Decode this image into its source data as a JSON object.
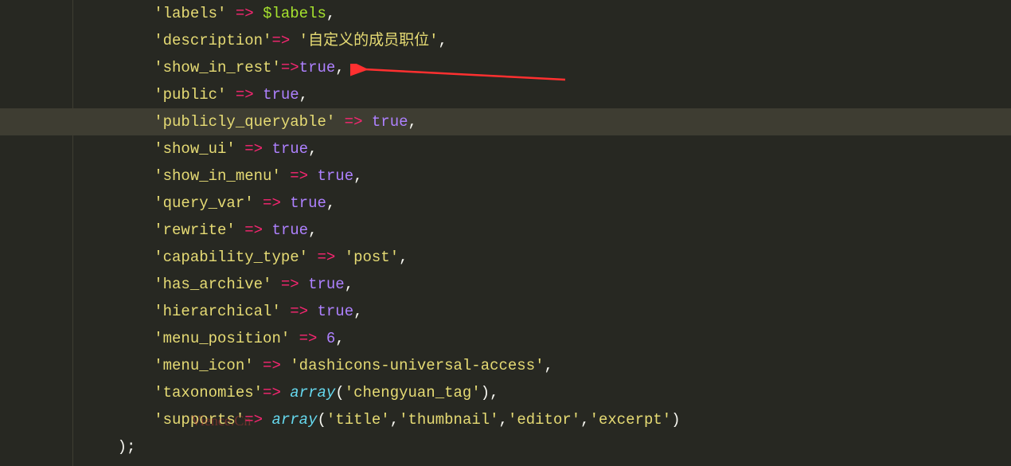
{
  "code": {
    "lines": [
      {
        "indent": "        ",
        "tokens": [
          {
            "t": "string",
            "v": "'labels'"
          },
          {
            "t": "punct",
            "v": " "
          },
          {
            "t": "operator",
            "v": "=>"
          },
          {
            "t": "punct",
            "v": " "
          },
          {
            "t": "variable",
            "v": "$labels"
          },
          {
            "t": "punct",
            "v": ","
          }
        ]
      },
      {
        "indent": "        ",
        "tokens": [
          {
            "t": "string",
            "v": "'description'"
          },
          {
            "t": "operator",
            "v": "=>"
          },
          {
            "t": "punct",
            "v": " "
          },
          {
            "t": "string",
            "v": "'自定义的成员职位'"
          },
          {
            "t": "punct",
            "v": ","
          }
        ]
      },
      {
        "indent": "        ",
        "tokens": [
          {
            "t": "string",
            "v": "'show_in_rest'"
          },
          {
            "t": "operator",
            "v": "=>"
          },
          {
            "t": "keyword",
            "v": "true"
          },
          {
            "t": "punct",
            "v": ","
          }
        ]
      },
      {
        "indent": "        ",
        "tokens": [
          {
            "t": "string",
            "v": "'public'"
          },
          {
            "t": "punct",
            "v": " "
          },
          {
            "t": "operator",
            "v": "=>"
          },
          {
            "t": "punct",
            "v": " "
          },
          {
            "t": "keyword",
            "v": "true"
          },
          {
            "t": "punct",
            "v": ","
          }
        ]
      },
      {
        "indent": "        ",
        "tokens": [
          {
            "t": "string",
            "v": "'publicly_queryable'"
          },
          {
            "t": "punct",
            "v": " "
          },
          {
            "t": "operator",
            "v": "=>"
          },
          {
            "t": "punct",
            "v": " "
          },
          {
            "t": "keyword",
            "v": "true"
          },
          {
            "t": "punct",
            "v": ","
          }
        ],
        "highlighted": true
      },
      {
        "indent": "        ",
        "tokens": [
          {
            "t": "string",
            "v": "'show_ui'"
          },
          {
            "t": "punct",
            "v": " "
          },
          {
            "t": "operator",
            "v": "=>"
          },
          {
            "t": "punct",
            "v": " "
          },
          {
            "t": "keyword",
            "v": "true"
          },
          {
            "t": "punct",
            "v": ","
          }
        ]
      },
      {
        "indent": "        ",
        "tokens": [
          {
            "t": "string",
            "v": "'show_in_menu'"
          },
          {
            "t": "punct",
            "v": " "
          },
          {
            "t": "operator",
            "v": "=>"
          },
          {
            "t": "punct",
            "v": " "
          },
          {
            "t": "keyword",
            "v": "true"
          },
          {
            "t": "punct",
            "v": ","
          }
        ]
      },
      {
        "indent": "        ",
        "tokens": [
          {
            "t": "string",
            "v": "'query_var'"
          },
          {
            "t": "punct",
            "v": " "
          },
          {
            "t": "operator",
            "v": "=>"
          },
          {
            "t": "punct",
            "v": " "
          },
          {
            "t": "keyword",
            "v": "true"
          },
          {
            "t": "punct",
            "v": ","
          }
        ]
      },
      {
        "indent": "        ",
        "tokens": [
          {
            "t": "string",
            "v": "'rewrite'"
          },
          {
            "t": "punct",
            "v": " "
          },
          {
            "t": "operator",
            "v": "=>"
          },
          {
            "t": "punct",
            "v": " "
          },
          {
            "t": "keyword",
            "v": "true"
          },
          {
            "t": "punct",
            "v": ","
          }
        ]
      },
      {
        "indent": "        ",
        "tokens": [
          {
            "t": "string",
            "v": "'capability_type'"
          },
          {
            "t": "punct",
            "v": " "
          },
          {
            "t": "operator",
            "v": "=>"
          },
          {
            "t": "punct",
            "v": " "
          },
          {
            "t": "string",
            "v": "'post'"
          },
          {
            "t": "punct",
            "v": ","
          }
        ]
      },
      {
        "indent": "        ",
        "tokens": [
          {
            "t": "string",
            "v": "'has_archive'"
          },
          {
            "t": "punct",
            "v": " "
          },
          {
            "t": "operator",
            "v": "=>"
          },
          {
            "t": "punct",
            "v": " "
          },
          {
            "t": "keyword",
            "v": "true"
          },
          {
            "t": "punct",
            "v": ","
          }
        ]
      },
      {
        "indent": "        ",
        "tokens": [
          {
            "t": "string",
            "v": "'hierarchical'"
          },
          {
            "t": "punct",
            "v": " "
          },
          {
            "t": "operator",
            "v": "=>"
          },
          {
            "t": "punct",
            "v": " "
          },
          {
            "t": "keyword",
            "v": "true"
          },
          {
            "t": "punct",
            "v": ","
          }
        ]
      },
      {
        "indent": "        ",
        "tokens": [
          {
            "t": "string",
            "v": "'menu_position'"
          },
          {
            "t": "punct",
            "v": " "
          },
          {
            "t": "operator",
            "v": "=>"
          },
          {
            "t": "punct",
            "v": " "
          },
          {
            "t": "number",
            "v": "6"
          },
          {
            "t": "punct",
            "v": ","
          }
        ]
      },
      {
        "indent": "        ",
        "tokens": [
          {
            "t": "string",
            "v": "'menu_icon'"
          },
          {
            "t": "punct",
            "v": " "
          },
          {
            "t": "operator",
            "v": "=>"
          },
          {
            "t": "punct",
            "v": " "
          },
          {
            "t": "string",
            "v": "'dashicons-universal-access'"
          },
          {
            "t": "punct",
            "v": ","
          }
        ]
      },
      {
        "indent": "        ",
        "tokens": [
          {
            "t": "string",
            "v": "'taxonomies'"
          },
          {
            "t": "operator",
            "v": "=>"
          },
          {
            "t": "punct",
            "v": " "
          },
          {
            "t": "func",
            "v": "array"
          },
          {
            "t": "paren",
            "v": "("
          },
          {
            "t": "string",
            "v": "'chengyuan_tag'"
          },
          {
            "t": "paren",
            "v": ")"
          },
          {
            "t": "punct",
            "v": ","
          }
        ]
      },
      {
        "indent": "        ",
        "tokens": [
          {
            "t": "string",
            "v": "'supports'"
          },
          {
            "t": "operator",
            "v": "=>"
          },
          {
            "t": "punct",
            "v": " "
          },
          {
            "t": "func",
            "v": "array"
          },
          {
            "t": "paren",
            "v": "("
          },
          {
            "t": "string",
            "v": "'title'"
          },
          {
            "t": "punct",
            "v": ","
          },
          {
            "t": "string",
            "v": "'thumbnail'"
          },
          {
            "t": "punct",
            "v": ","
          },
          {
            "t": "string",
            "v": "'editor'"
          },
          {
            "t": "punct",
            "v": ","
          },
          {
            "t": "string",
            "v": "'excerpt'"
          },
          {
            "t": "paren",
            "v": ")"
          }
        ]
      },
      {
        "indent": "    ",
        "tokens": [
          {
            "t": "paren",
            "v": ")"
          },
          {
            "t": "punct",
            "v": ";"
          }
        ]
      }
    ]
  },
  "watermark": "Vience.Cn"
}
